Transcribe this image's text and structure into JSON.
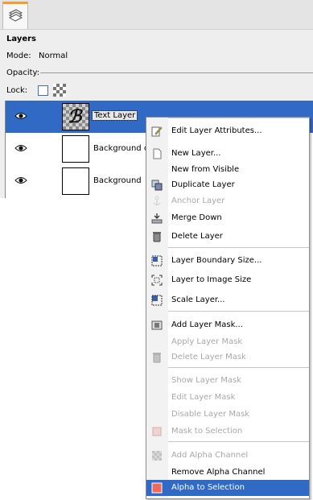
{
  "panel": {
    "title": "Layers",
    "mode_label": "Mode:",
    "mode_value": "Normal",
    "opacity_label": "Opacity:",
    "lock_label": "Lock:"
  },
  "layers": [
    {
      "name": "Text Layer",
      "visible": true,
      "selected": true
    },
    {
      "name": "Background copy",
      "visible": true,
      "selected": false
    },
    {
      "name": "Background",
      "visible": true,
      "selected": false
    }
  ],
  "menu": [
    {
      "label": "Edit Layer Attributes...",
      "icon": "edit-attributes-icon",
      "enabled": true
    },
    {
      "sep": true
    },
    {
      "label": "New Layer...",
      "icon": "new-layer-icon",
      "enabled": true
    },
    {
      "label": "New from Visible",
      "icon": "",
      "enabled": true
    },
    {
      "label": "Duplicate Layer",
      "icon": "duplicate-layer-icon",
      "enabled": true
    },
    {
      "label": "Anchor Layer",
      "icon": "anchor-icon",
      "enabled": false
    },
    {
      "label": "Merge Down",
      "icon": "merge-down-icon",
      "enabled": true
    },
    {
      "label": "Delete Layer",
      "icon": "trash-icon",
      "enabled": true
    },
    {
      "sep": true
    },
    {
      "label": "Layer Boundary Size...",
      "icon": "boundary-size-icon",
      "enabled": true
    },
    {
      "label": "Layer to Image Size",
      "icon": "layer-to-image-size-icon",
      "enabled": true
    },
    {
      "label": "Scale Layer...",
      "icon": "scale-layer-icon",
      "enabled": true
    },
    {
      "sep": true
    },
    {
      "label": "Add Layer Mask...",
      "icon": "add-mask-icon",
      "enabled": true
    },
    {
      "label": "Apply Layer Mask",
      "icon": "",
      "enabled": false
    },
    {
      "label": "Delete Layer Mask",
      "icon": "trash-icon",
      "enabled": false
    },
    {
      "sep": true
    },
    {
      "label": "Show Layer Mask",
      "icon": "",
      "enabled": false
    },
    {
      "label": "Edit Layer Mask",
      "icon": "",
      "enabled": false
    },
    {
      "label": "Disable Layer Mask",
      "icon": "",
      "enabled": false
    },
    {
      "label": "Mask to Selection",
      "icon": "mask-to-selection-icon",
      "enabled": false
    },
    {
      "sep": true
    },
    {
      "label": "Add Alpha Channel",
      "icon": "alpha-channel-icon",
      "enabled": false
    },
    {
      "label": "Remove Alpha Channel",
      "icon": "",
      "enabled": true
    },
    {
      "label": "Alpha to Selection",
      "icon": "alpha-to-selection-icon",
      "enabled": true,
      "highlighted": true
    }
  ],
  "colors": {
    "selection": "#316ac5",
    "disabled_text": "#a8a8a8",
    "tab_accent": "#f0a030"
  }
}
